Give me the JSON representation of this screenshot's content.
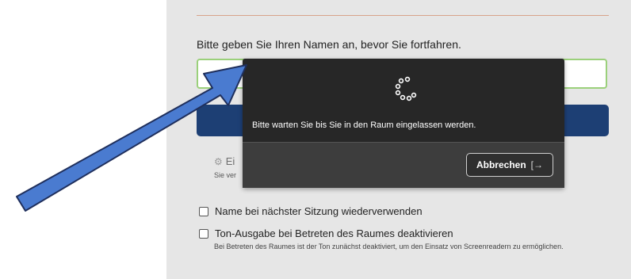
{
  "join_form": {
    "prompt": "Bitte geben Sie Ihren Namen an, bevor Sie fortfahren.",
    "name_value": "",
    "settings_label": "Ei",
    "settings_note": "Sie ver"
  },
  "options": [
    {
      "label": "Name bei nächster Sitzung wiederverwenden",
      "checked": false
    },
    {
      "label": "Ton-Ausgabe bei Betreten des Raumes deaktivieren",
      "checked": false,
      "note": "Bei Betreten des Raumes ist der Ton zunächst deaktiviert, um den Einsatz von Screenreadern zu ermöglichen."
    }
  ],
  "modal": {
    "message": "Bitte warten Sie bis Sie in den Raum eingelassen werden.",
    "cancel_label": "Abbrechen",
    "cancel_icon": "exit-arrow-icon"
  },
  "overlay": {
    "arrow_color": "#4a7bd0",
    "arrow_outline": "#1f2f5c"
  }
}
